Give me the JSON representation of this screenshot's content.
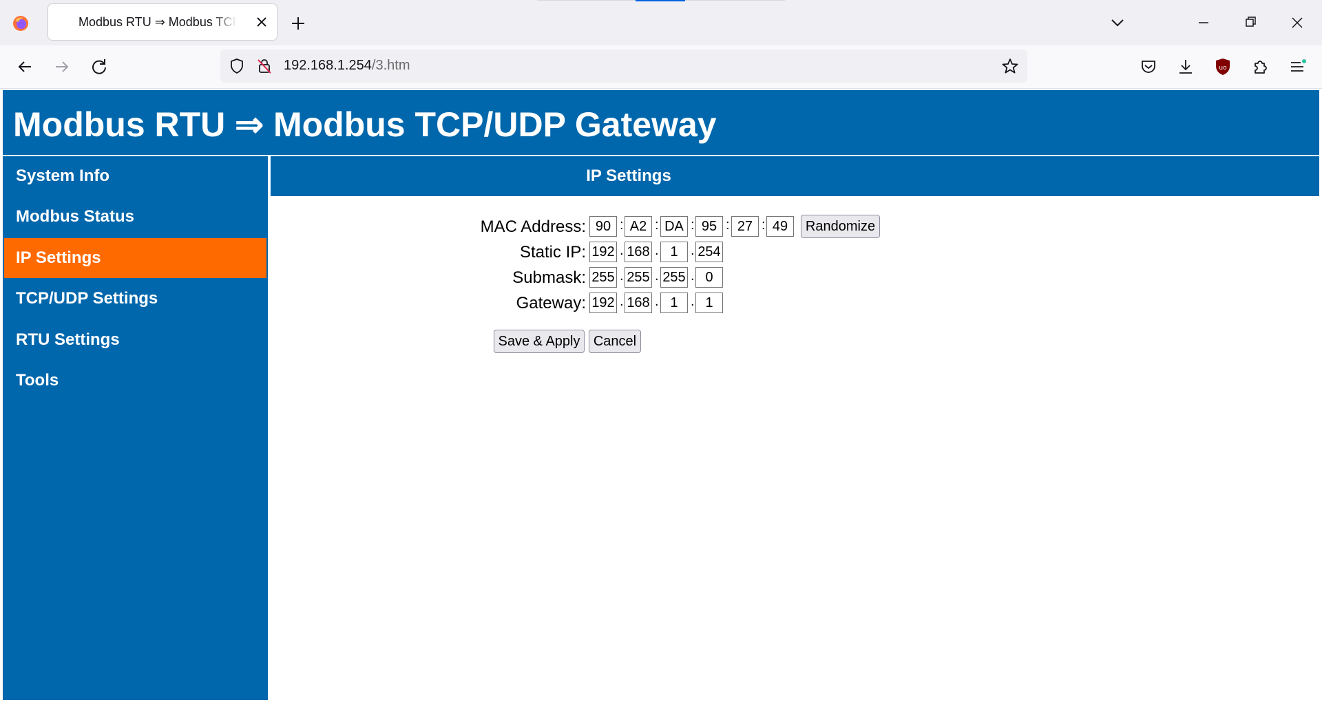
{
  "browser": {
    "tab_title": "Modbus RTU ⇒ Modbus TCP/UDP Gateway",
    "url_host": "192.168.1.254",
    "url_path": "/3.htm"
  },
  "page": {
    "header_title": "Modbus RTU ⇒ Modbus TCP/UDP Gateway",
    "sidebar": [
      {
        "label": "System Info",
        "active": false
      },
      {
        "label": "Modbus Status",
        "active": false
      },
      {
        "label": "IP Settings",
        "active": true
      },
      {
        "label": "TCP/UDP Settings",
        "active": false
      },
      {
        "label": "RTU Settings",
        "active": false
      },
      {
        "label": "Tools",
        "active": false
      }
    ],
    "content_title": "IP Settings",
    "form": {
      "mac_label": "MAC Address:",
      "mac": [
        "90",
        "A2",
        "DA",
        "95",
        "27",
        "49"
      ],
      "mac_sep": ":",
      "randomize_label": "Randomize",
      "ip_label": "Static IP:",
      "ip": [
        "192",
        "168",
        "1",
        "254"
      ],
      "mask_label": "Submask:",
      "mask": [
        "255",
        "255",
        "255",
        "0"
      ],
      "gw_label": "Gateway:",
      "gw": [
        "192",
        "168",
        "1",
        "1"
      ],
      "ip_sep": ".",
      "save_label": "Save & Apply",
      "cancel_label": "Cancel"
    }
  },
  "colors": {
    "header_blue": "#0067ac",
    "active_orange": "#ff6a00"
  }
}
